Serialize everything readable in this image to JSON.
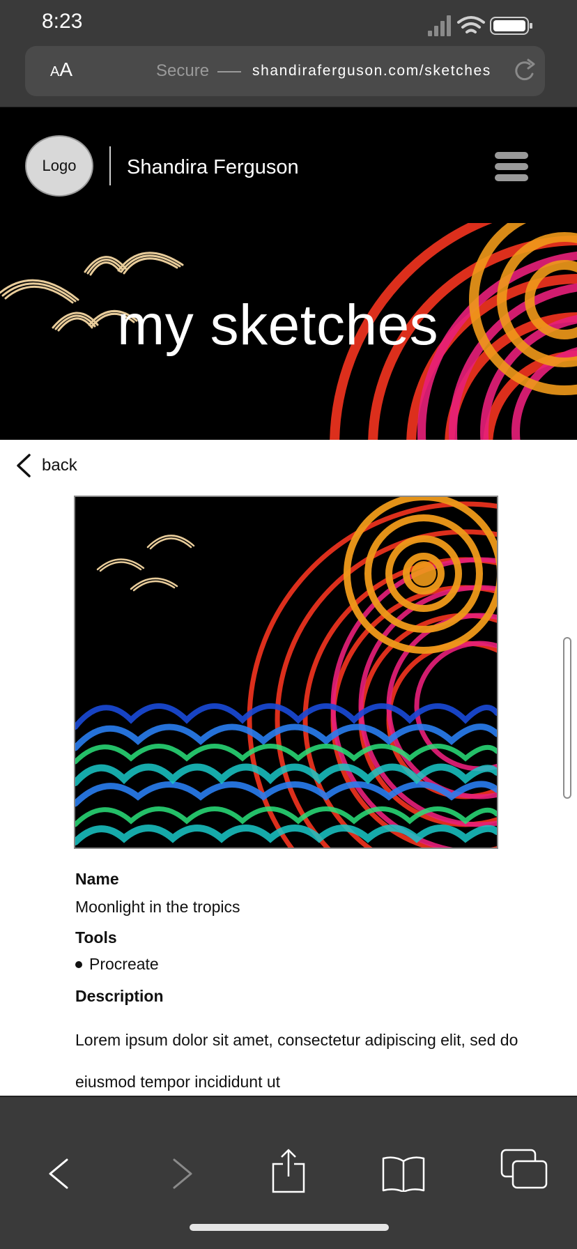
{
  "status_bar": {
    "time": "8:23"
  },
  "address_bar": {
    "text_size_button": "AA",
    "secure_label": "Secure",
    "url": "shandiraferguson.com/sketches"
  },
  "site_header": {
    "logo_label": "Logo",
    "site_name": "Shandira Ferguson"
  },
  "hero": {
    "title": "my sketches"
  },
  "content": {
    "back_label": "back",
    "name_label": "Name",
    "name_value": "Moonlight in the tropics",
    "tools_label": "Tools",
    "tools": [
      "Procreate"
    ],
    "description_label": "Description",
    "description": "Lorem ipsum dolor sit amet, consectetur adipiscing elit, sed do eiusmod tempor incididunt ut"
  },
  "toolbar": {
    "icons": [
      "back-arrow-icon",
      "forward-arrow-icon",
      "share-icon",
      "bookmarks-icon",
      "tabs-icon"
    ]
  },
  "colors": {
    "chrome_bg": "#3a3a3a",
    "address_bg": "#4a4a4a",
    "hero_bg": "#000000",
    "red": "#e8321e",
    "magenta": "#e8207a",
    "orange": "#f09a1a",
    "bird_gold": "#e8cc9a",
    "wave_blue": "#2a7ef0",
    "wave_teal": "#1ac8c8",
    "wave_green": "#2ae07a"
  }
}
